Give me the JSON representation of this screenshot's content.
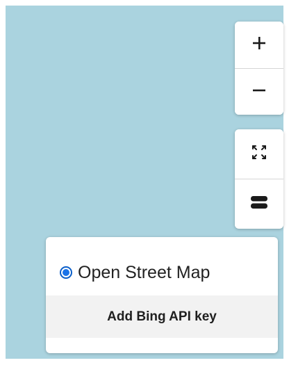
{
  "map": {
    "background_color": "#aad3df"
  },
  "zoom_controls": {
    "zoom_in_icon": "plus-icon",
    "zoom_out_icon": "minus-icon"
  },
  "view_controls": {
    "fullscreen_icon": "expand-arrows-icon",
    "layers_icon": "layers-icon"
  },
  "layer_panel": {
    "options": [
      {
        "label": "Open Street Map",
        "selected": true
      }
    ],
    "bing_button_label": "Add Bing API key"
  },
  "colors": {
    "radio_selected": "#1a73e8",
    "panel_background": "#ffffff",
    "button_background": "#f2f2f2"
  }
}
